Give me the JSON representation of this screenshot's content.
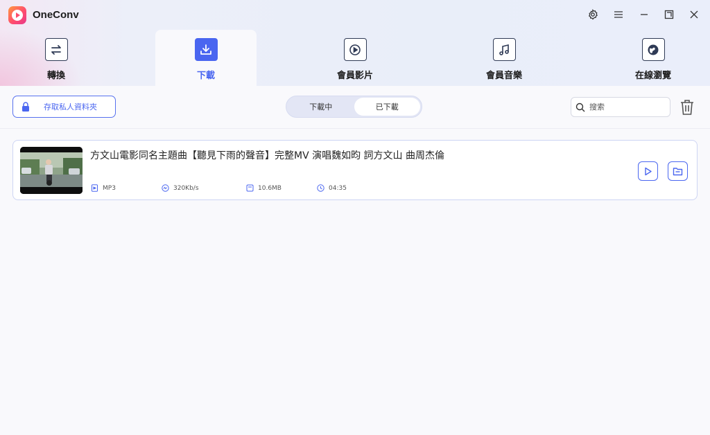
{
  "app": {
    "title": "OneConv"
  },
  "window_controls": [
    "settings-icon",
    "menu-icon",
    "minimize-icon",
    "maximize-icon",
    "close-icon"
  ],
  "tabs": [
    {
      "label": "轉換",
      "icon": "convert-icon",
      "active": false
    },
    {
      "label": "下載",
      "icon": "download-icon",
      "active": true
    },
    {
      "label": "會員影片",
      "icon": "video-icon",
      "active": false
    },
    {
      "label": "會員音樂",
      "icon": "music-icon",
      "active": false
    },
    {
      "label": "在線瀏覽",
      "icon": "browser-icon",
      "active": false
    }
  ],
  "toolbar": {
    "private_folder_label": "存取私人資料夾",
    "segment": {
      "options": [
        "下載中",
        "已下載"
      ],
      "selected": "已下載"
    },
    "search": {
      "placeholder": "搜索",
      "value": ""
    }
  },
  "downloads": [
    {
      "title": "方文山電影同名主題曲【聽見下雨的聲音】完整MV 演唱魏如昀 詞方文山 曲周杰倫",
      "format": "MP3",
      "bitrate": "320Kb/s",
      "size": "10.6MB",
      "duration": "04:35"
    }
  ],
  "colors": {
    "accent": "#4a66f0",
    "text": "#222222",
    "item_border": "#cdd4f3"
  }
}
